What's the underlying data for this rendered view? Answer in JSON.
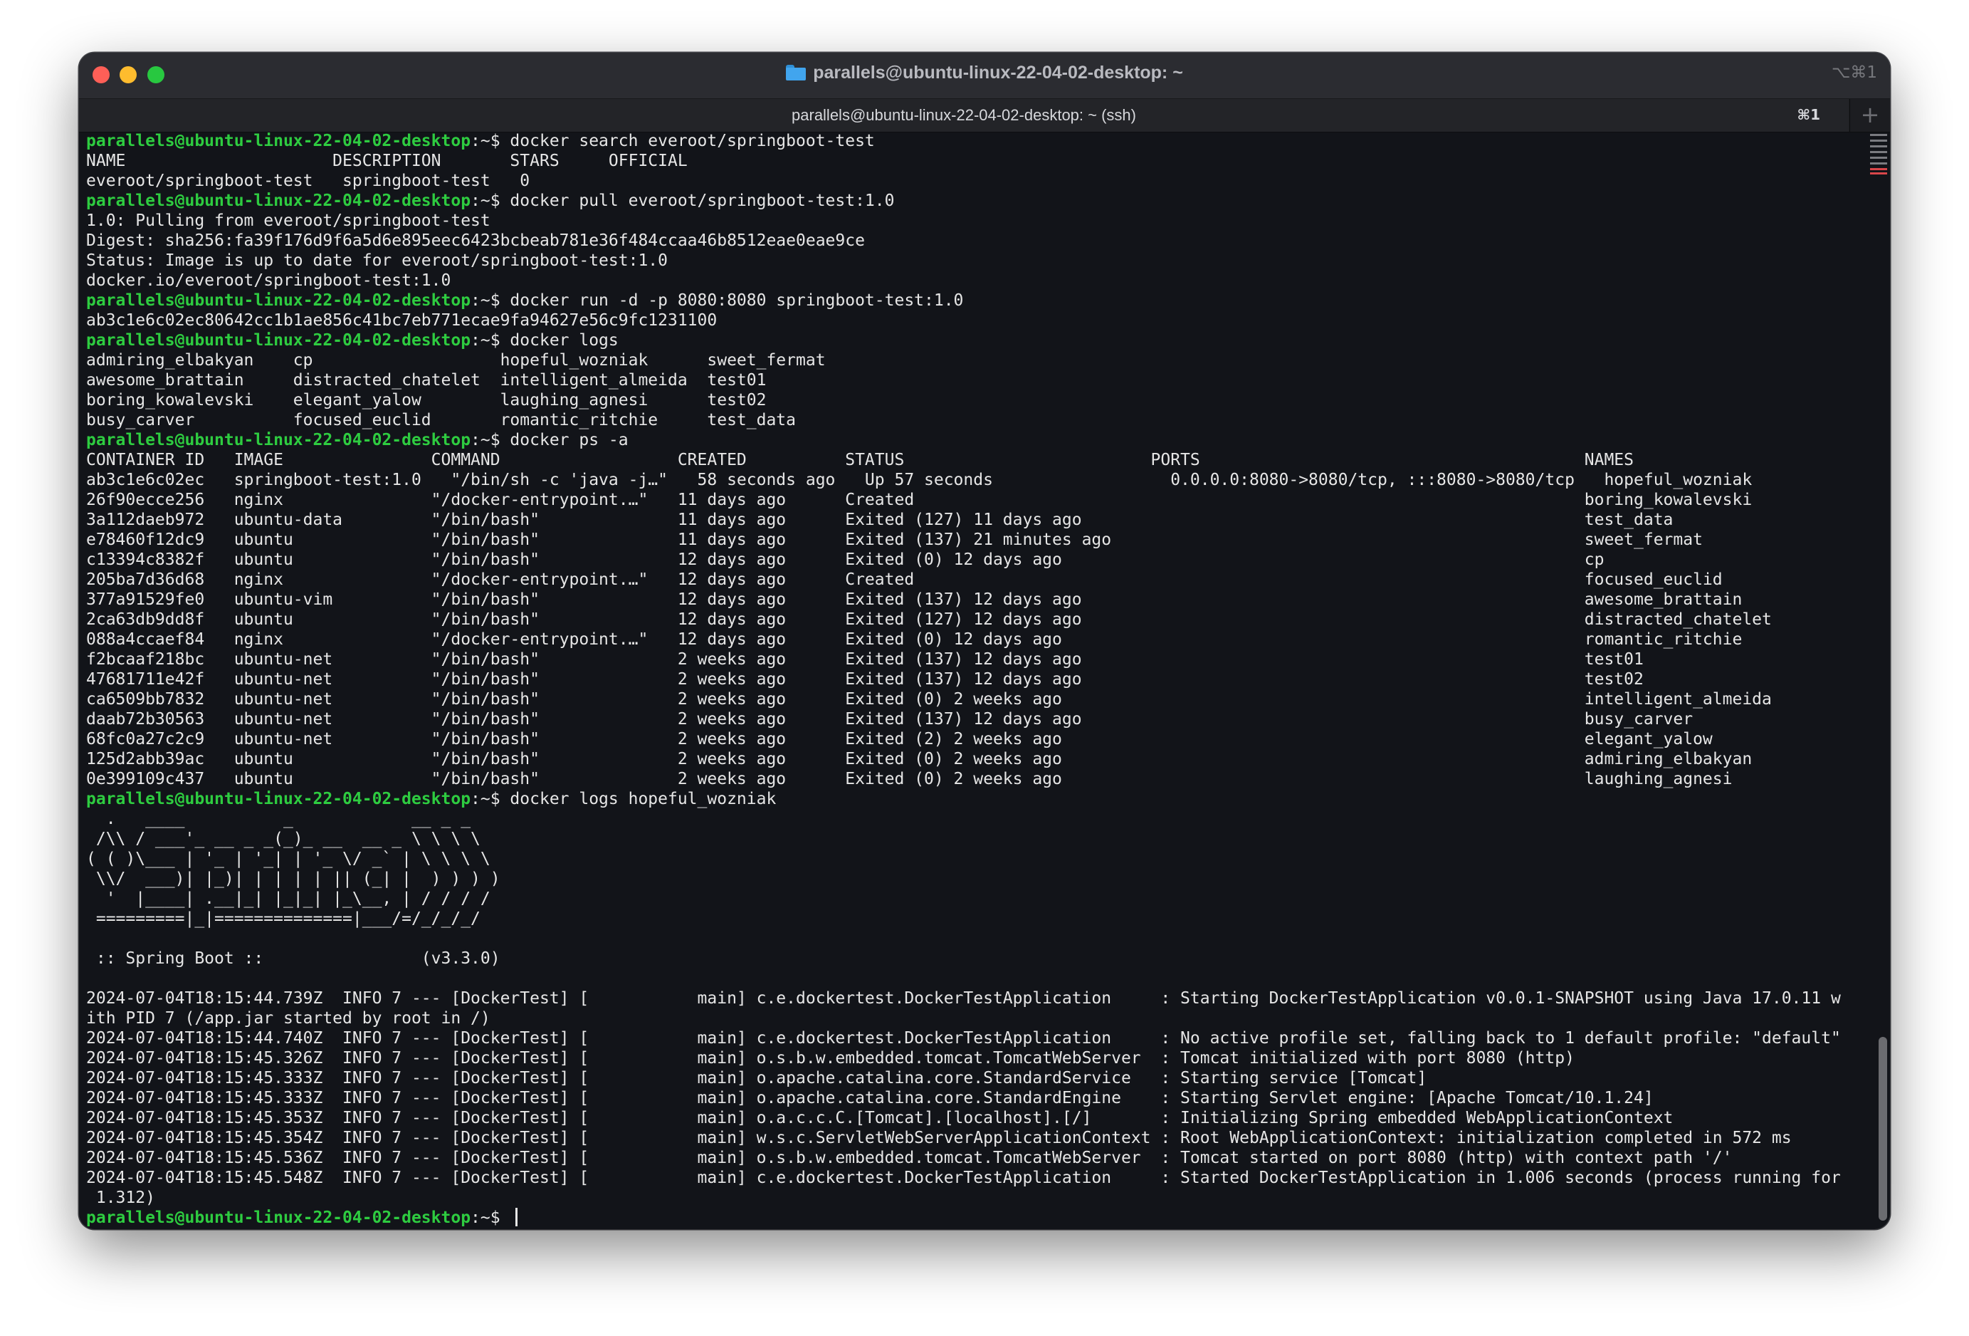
{
  "window": {
    "title": "parallels@ubuntu-linux-22-04-02-desktop: ~",
    "title_icon": "folder-icon",
    "title_shortcut": "⌥⌘1",
    "tab_title": "parallels@ubuntu-linux-22-04-02-desktop: ~ (ssh)",
    "tab_shortcut": "⌘1",
    "new_tab_label": "+"
  },
  "colors": {
    "prompt": "#2ecc40",
    "background": "#121419",
    "text": "#e6e6e6"
  },
  "terminal": {
    "prompt": "parallels@ubuntu-linux-22-04-02-desktop",
    "lines": [
      {
        "p": true,
        "t": ":~$ docker search everoot/springboot-test"
      },
      {
        "t": "NAME                     DESCRIPTION       STARS     OFFICIAL"
      },
      {
        "t": "everoot/springboot-test   springboot-test   0"
      },
      {
        "p": true,
        "t": ":~$ docker pull everoot/springboot-test:1.0"
      },
      {
        "t": "1.0: Pulling from everoot/springboot-test"
      },
      {
        "t": "Digest: sha256:fa39f176d9f6a5d6e895eec6423bcbeab781e36f484ccaa46b8512eae0eae9ce"
      },
      {
        "t": "Status: Image is up to date for everoot/springboot-test:1.0"
      },
      {
        "t": "docker.io/everoot/springboot-test:1.0"
      },
      {
        "p": true,
        "t": ":~$ docker run -d -p 8080:8080 springboot-test:1.0"
      },
      {
        "t": "ab3c1e6c02ec80642cc1b1ae856c41bc7eb771ecae9fa94627e56c9fc1231100"
      },
      {
        "p": true,
        "t": ":~$ docker logs"
      },
      {
        "t": "admiring_elbakyan    cp                   hopeful_wozniak      sweet_fermat"
      },
      {
        "t": "awesome_brattain     distracted_chatelet  intelligent_almeida  test01"
      },
      {
        "t": "boring_kowalevski    elegant_yalow        laughing_agnesi      test02"
      },
      {
        "t": "busy_carver          focused_euclid       romantic_ritchie     test_data"
      },
      {
        "p": true,
        "t": ":~$ docker ps -a"
      },
      {
        "t": "CONTAINER ID   IMAGE               COMMAND                  CREATED          STATUS                         PORTS                                       NAMES"
      },
      {
        "t": "ab3c1e6c02ec   springboot-test:1.0   \"/bin/sh -c 'java -j…\"   58 seconds ago   Up 57 seconds                  0.0.0.0:8080->8080/tcp, :::8080->8080/tcp   hopeful_wozniak"
      },
      {
        "t": "26f90ecce256   nginx               \"/docker-entrypoint.…\"   11 days ago      Created                                                                    boring_kowalevski"
      },
      {
        "t": "3a112daeb972   ubuntu-data         \"/bin/bash\"              11 days ago      Exited (127) 11 days ago                                                   test_data"
      },
      {
        "t": "e78460f12dc9   ubuntu              \"/bin/bash\"              11 days ago      Exited (137) 21 minutes ago                                                sweet_fermat"
      },
      {
        "t": "c13394c8382f   ubuntu              \"/bin/bash\"              12 days ago      Exited (0) 12 days ago                                                     cp"
      },
      {
        "t": "205ba7d36d68   nginx               \"/docker-entrypoint.…\"   12 days ago      Created                                                                    focused_euclid"
      },
      {
        "t": "377a91529fe0   ubuntu-vim          \"/bin/bash\"              12 days ago      Exited (137) 12 days ago                                                   awesome_brattain"
      },
      {
        "t": "2ca63db9dd8f   ubuntu              \"/bin/bash\"              12 days ago      Exited (127) 12 days ago                                                   distracted_chatelet"
      },
      {
        "t": "088a4ccaef84   nginx               \"/docker-entrypoint.…\"   12 days ago      Exited (0) 12 days ago                                                     romantic_ritchie"
      },
      {
        "t": "f2bcaaf218bc   ubuntu-net          \"/bin/bash\"              2 weeks ago      Exited (137) 12 days ago                                                   test01"
      },
      {
        "t": "47681711e42f   ubuntu-net          \"/bin/bash\"              2 weeks ago      Exited (137) 12 days ago                                                   test02"
      },
      {
        "t": "ca6509bb7832   ubuntu-net          \"/bin/bash\"              2 weeks ago      Exited (0) 2 weeks ago                                                     intelligent_almeida"
      },
      {
        "t": "daab72b30563   ubuntu-net          \"/bin/bash\"              2 weeks ago      Exited (137) 12 days ago                                                   busy_carver"
      },
      {
        "t": "68fc0a27c2c9   ubuntu-net          \"/bin/bash\"              2 weeks ago      Exited (2) 2 weeks ago                                                     elegant_yalow"
      },
      {
        "t": "125d2abb39ac   ubuntu              \"/bin/bash\"              2 weeks ago      Exited (0) 2 weeks ago                                                     admiring_elbakyan"
      },
      {
        "t": "0e399109c437   ubuntu              \"/bin/bash\"              2 weeks ago      Exited (0) 2 weeks ago                                                     laughing_agnesi"
      },
      {
        "p": true,
        "t": ":~$ docker logs hopeful_wozniak"
      },
      {
        "t": "  .   ____          _            __ _ _"
      },
      {
        "t": " /\\\\ / ___'_ __ _ _(_)_ __  __ _ \\ \\ \\ \\"
      },
      {
        "t": "( ( )\\___ | '_ | '_| | '_ \\/ _` | \\ \\ \\ \\"
      },
      {
        "t": " \\\\/  ___)| |_)| | | | | || (_| |  ) ) ) )"
      },
      {
        "t": "  '  |____| .__|_| |_|_| |_\\__, | / / / /"
      },
      {
        "t": " =========|_|==============|___/=/_/_/_/"
      },
      {
        "t": ""
      },
      {
        "t": " :: Spring Boot ::                (v3.3.0)"
      },
      {
        "t": ""
      },
      {
        "t": "2024-07-04T18:15:44.739Z  INFO 7 --- [DockerTest] [           main] c.e.dockertest.DockerTestApplication     : Starting DockerTestApplication v0.0.1-SNAPSHOT using Java 17.0.11 w"
      },
      {
        "t": "ith PID 7 (/app.jar started by root in /)"
      },
      {
        "t": "2024-07-04T18:15:44.740Z  INFO 7 --- [DockerTest] [           main] c.e.dockertest.DockerTestApplication     : No active profile set, falling back to 1 default profile: \"default\""
      },
      {
        "t": "2024-07-04T18:15:45.326Z  INFO 7 --- [DockerTest] [           main] o.s.b.w.embedded.tomcat.TomcatWebServer  : Tomcat initialized with port 8080 (http)"
      },
      {
        "t": "2024-07-04T18:15:45.333Z  INFO 7 --- [DockerTest] [           main] o.apache.catalina.core.StandardService   : Starting service [Tomcat]"
      },
      {
        "t": "2024-07-04T18:15:45.333Z  INFO 7 --- [DockerTest] [           main] o.apache.catalina.core.StandardEngine    : Starting Servlet engine: [Apache Tomcat/10.1.24]"
      },
      {
        "t": "2024-07-04T18:15:45.353Z  INFO 7 --- [DockerTest] [           main] o.a.c.c.C.[Tomcat].[localhost].[/]       : Initializing Spring embedded WebApplicationContext"
      },
      {
        "t": "2024-07-04T18:15:45.354Z  INFO 7 --- [DockerTest] [           main] w.s.c.ServletWebServerApplicationContext : Root WebApplicationContext: initialization completed in 572 ms"
      },
      {
        "t": "2024-07-04T18:15:45.536Z  INFO 7 --- [DockerTest] [           main] o.s.b.w.embedded.tomcat.TomcatWebServer  : Tomcat started on port 8080 (http) with context path '/'"
      },
      {
        "t": "2024-07-04T18:15:45.548Z  INFO 7 --- [DockerTest] [           main] c.e.dockertest.DockerTestApplication     : Started DockerTestApplication in 1.006 seconds (process running for"
      },
      {
        "t": " 1.312)"
      },
      {
        "p": true,
        "t": ":~$ ",
        "cursor": true
      }
    ]
  }
}
